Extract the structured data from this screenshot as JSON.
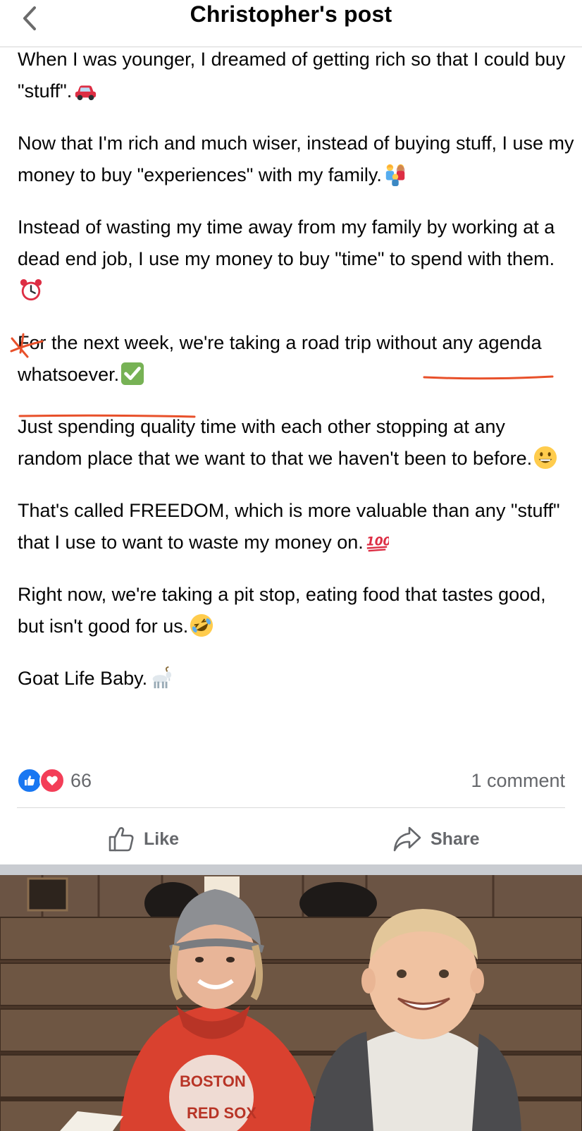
{
  "header": {
    "title": "Christopher's post",
    "back_icon": "chevron-left-icon"
  },
  "post": {
    "paragraphs": [
      "When I was younger, I dreamed of getting rich so that I could buy \"stuff\".",
      "Now that I'm rich and much wiser, instead of buying stuff, I use my money to buy \"experiences\" with my family.",
      "Instead of wasting my time away from my family by working at a dead end job, I use my money to buy \"time\" to spend with them.",
      "For the next week, we're taking a road trip without any agenda whatsoever.",
      "Just spending quality time with each other stopping at any random place that we want to that we haven't been to before.",
      "That's called FREEDOM, which is more valuable than any \"stuff\" that I use to want to waste my money on.",
      "Right now, we're taking a pit stop, eating food that tastes good, but isn't good for us.",
      "Goat Life Baby."
    ],
    "p4_before": "For the next week, we're taking a road trip ",
    "p4_underlined": "without any agenda whatsoever",
    "p4_after": ".",
    "emojis": [
      "car-emoji",
      "family-emoji",
      "alarm-clock-emoji",
      "check-mark-emoji",
      "grinning-face-emoji",
      "hundred-points-emoji",
      "rolling-laughing-emoji",
      "goat-emoji"
    ],
    "annotation_color": "#e8502a"
  },
  "stats": {
    "reaction_icons": [
      "like-icon",
      "love-icon"
    ],
    "reaction_count": "66",
    "comment_count": "1 comment"
  },
  "actions": {
    "like_label": "Like",
    "share_label": "Share"
  },
  "photo": {
    "description_icon": "photo-mother-and-child",
    "shirt_text": "BOSTON RED SOX"
  },
  "colors": {
    "like_blue": "#1877f2",
    "love_red": "#f33e58",
    "secondary_text": "#65676b"
  }
}
